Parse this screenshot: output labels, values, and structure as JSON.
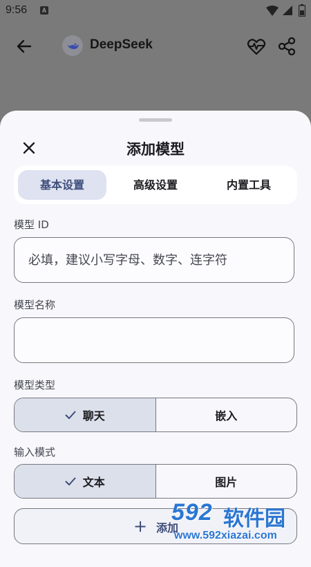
{
  "status_bar": {
    "time": "9:56",
    "notification_letter": "A"
  },
  "app_bar": {
    "title": "DeepSeek"
  },
  "sheet": {
    "title": "添加模型",
    "tabs": [
      {
        "label": "基本设置",
        "active": true
      },
      {
        "label": "高级设置",
        "active": false
      },
      {
        "label": "内置工具",
        "active": false
      }
    ],
    "model_id": {
      "label": "模型 ID",
      "placeholder": "必填，建议小写字母、数字、连字符",
      "value": ""
    },
    "model_name": {
      "label": "模型名称",
      "placeholder": "",
      "value": ""
    },
    "model_type": {
      "label": "模型类型",
      "options": [
        {
          "label": "聊天",
          "selected": true
        },
        {
          "label": "嵌入",
          "selected": false
        }
      ]
    },
    "input_mode": {
      "label": "输入模式",
      "options": [
        {
          "label": "文本",
          "selected": true
        },
        {
          "label": "图片",
          "selected": false
        }
      ]
    },
    "add_button": {
      "label": "添加"
    }
  },
  "watermark": {
    "logo": "592",
    "name": "软件园",
    "url": "www.592xiazai.com"
  },
  "colors": {
    "accent": "#3d4d7a",
    "selected_bg": "#dce0ea",
    "sheet_bg": "#f8f8fc",
    "scrim": "#7a7a7a",
    "watermark": "#2a76d2"
  }
}
